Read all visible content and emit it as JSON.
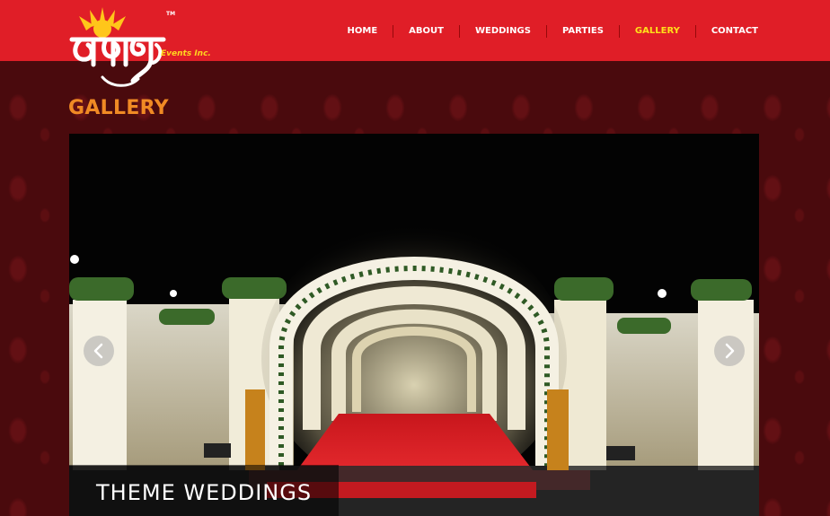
{
  "brand": {
    "logo_script": "तथास्तु",
    "logo_subtitle": "Events Inc.",
    "trademark": "TM",
    "colors": {
      "header": "#e01e27",
      "logo_sun": "#ffc61a",
      "accent_title": "#f08a24",
      "active_nav": "#ffe01a"
    }
  },
  "nav": {
    "items": [
      {
        "label": "HOME"
      },
      {
        "label": "ABOUT"
      },
      {
        "label": "WEDDINGS"
      },
      {
        "label": "PARTIES"
      },
      {
        "label": "GALLERY",
        "active": true
      },
      {
        "label": "CONTACT"
      }
    ]
  },
  "page": {
    "title": "GALLERY"
  },
  "slider": {
    "caption": "THEME WEDDINGS",
    "prev_icon": "chevron-left-icon",
    "next_icon": "chevron-right-icon"
  }
}
